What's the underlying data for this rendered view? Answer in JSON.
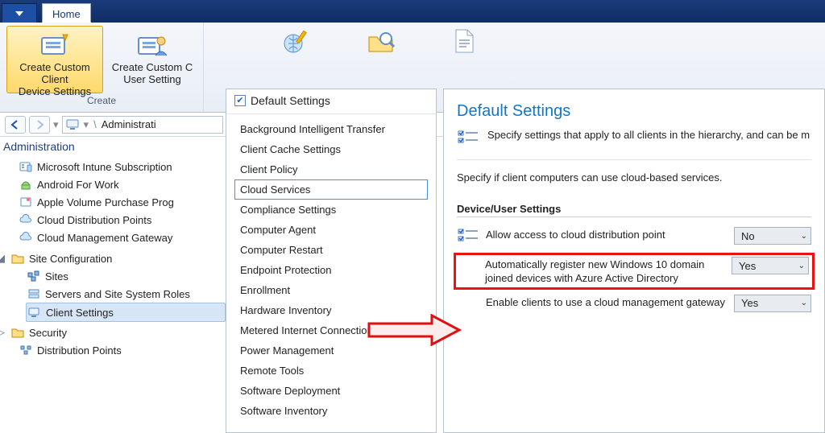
{
  "ribbon": {
    "tab": "Home",
    "group_caption": "Create",
    "btn_custom_client": "Create Custom Client\nDevice Settings",
    "btn_custom_user": "Create Custom C\nUser Setting"
  },
  "nav": {
    "address_label": "Administrati"
  },
  "tree": {
    "section_label": "Administration",
    "items": [
      {
        "label": "Microsoft Intune Subscription",
        "icon": "intune"
      },
      {
        "label": "Android For Work",
        "icon": "android"
      },
      {
        "label": "Apple Volume Purchase Prog",
        "icon": "apple"
      },
      {
        "label": "Cloud Distribution Points",
        "icon": "cloud"
      },
      {
        "label": "Cloud Management Gateway",
        "icon": "cloud"
      }
    ],
    "site_config_label": "Site Configuration",
    "site_config_items": [
      {
        "label": "Sites",
        "icon": "sites"
      },
      {
        "label": "Servers and Site System Roles",
        "icon": "servers"
      },
      {
        "label": "Client Settings",
        "icon": "client",
        "selected": true
      }
    ],
    "security_label": "Security",
    "dp_label": "Distribution Points"
  },
  "list_panel": {
    "header": "Default Settings",
    "items": [
      "Background Intelligent Transfer",
      "Client Cache Settings",
      "Client Policy",
      "Cloud Services",
      "Compliance Settings",
      "Computer Agent",
      "Computer Restart",
      "Endpoint Protection",
      "Enrollment",
      "Hardware Inventory",
      "Metered Internet Connections",
      "Power Management",
      "Remote Tools",
      "Software Deployment",
      "Software Inventory"
    ],
    "selected_index": 3
  },
  "details": {
    "title": "Default Settings",
    "head_text": "Specify settings that apply to all clients in the hierarchy, and can be m",
    "sub_desc": "Specify if client computers can use cloud-based services.",
    "section_label": "Device/User Settings",
    "rows": [
      {
        "label": "Allow access to cloud distribution point",
        "value": "No",
        "icon": true
      },
      {
        "label": "Automatically register new Windows 10 domain joined devices with Azure Active Directory",
        "value": "Yes",
        "highlight": true,
        "icon": false
      },
      {
        "label": "Enable clients to use a cloud management gateway",
        "value": "Yes",
        "icon": false
      }
    ]
  }
}
